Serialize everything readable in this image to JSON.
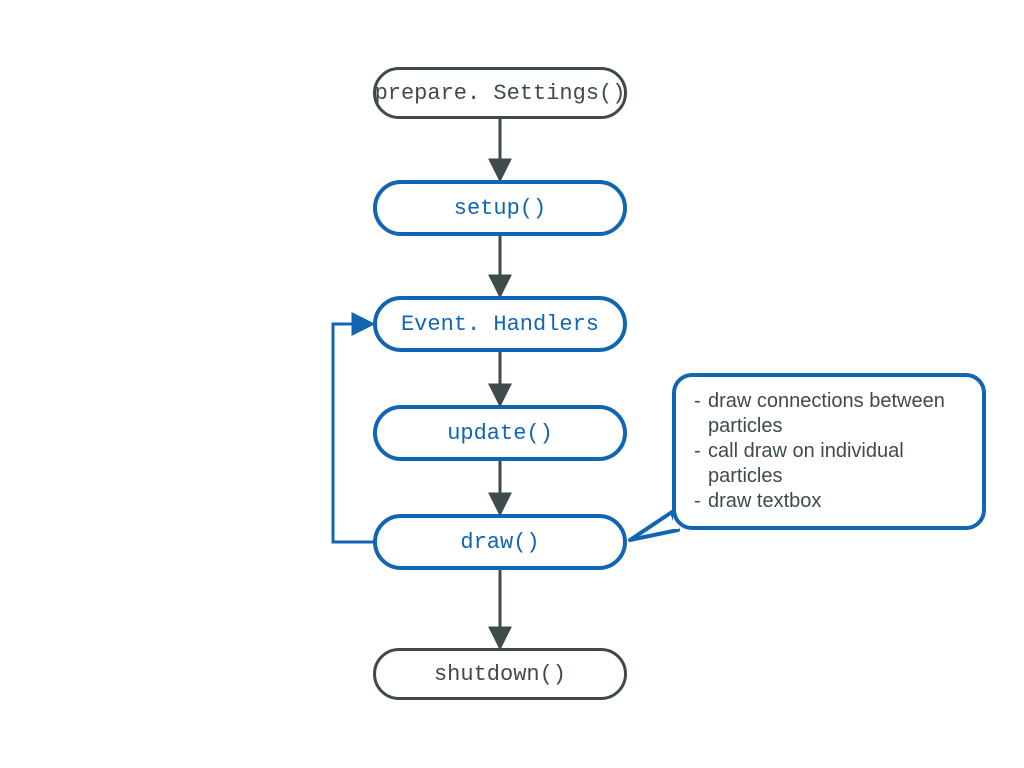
{
  "colors": {
    "gray": "#3f4a4a",
    "blue": "#1066b3"
  },
  "nodes": {
    "prepareSettings": {
      "label": "prepare. Settings()"
    },
    "setup": {
      "label": "setup()"
    },
    "eventHandlers": {
      "label": "Event. Handlers"
    },
    "update": {
      "label": "update()"
    },
    "draw": {
      "label": "draw()"
    },
    "shutdown": {
      "label": "shutdown()"
    }
  },
  "callout": {
    "lines": [
      "draw connections between particles",
      "call draw on individual particles",
      "draw textbox"
    ]
  }
}
